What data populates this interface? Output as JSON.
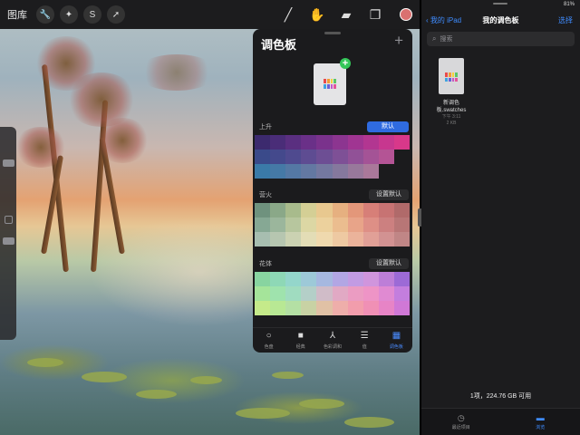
{
  "toolbar": {
    "gallery": "图库",
    "left_icons": [
      "wrench-icon",
      "magic-wand-icon",
      "selection-icon",
      "transform-arrow-icon"
    ],
    "right_tools": [
      "brush-icon",
      "smudge-icon",
      "eraser-icon",
      "layers-icon"
    ],
    "current_color": "#d97070"
  },
  "panel": {
    "title": "调色板",
    "add": "+",
    "palettes": [
      {
        "name": "上升",
        "default_label": "默认",
        "is_default": true,
        "rows": [
          [
            "#3c2a6e",
            "#4a2d78",
            "#5a2f80",
            "#6a3088",
            "#7a328c",
            "#8c3590",
            "#a03592",
            "#b23691",
            "#c7378f",
            "#d8388a"
          ],
          [
            "#3a4a8a",
            "#44498c",
            "#4f4a8f",
            "#5e4c92",
            "#6d4e94",
            "#7e5096",
            "#915197",
            "#a45396",
            "#b45495",
            "#1b1b1d"
          ],
          [
            "#3a7aa8",
            "#4579a6",
            "#5478a4",
            "#6378a2",
            "#7478a0",
            "#85789d",
            "#98789b",
            "#aa789a",
            "#1b1b1d",
            "#1b1b1d"
          ]
        ]
      },
      {
        "name": "营火",
        "default_label": "设置默认",
        "is_default": false,
        "rows": [
          [
            "#6f927e",
            "#8aa888",
            "#a8bb8c",
            "#d4cf95",
            "#e8c88f",
            "#e6b080",
            "#e3977a",
            "#d77f78",
            "#c77373",
            "#b06a6a"
          ],
          [
            "#86a894",
            "#9bb69c",
            "#b7c69e",
            "#dcd7a4",
            "#ecd19d",
            "#ebbd8f",
            "#e8a489",
            "#de8f86",
            "#cc8080",
            "#b87676"
          ],
          [
            "#a7beb0",
            "#b6c6b0",
            "#cbd2b2",
            "#e3ddb6",
            "#efd9ae",
            "#eec9a2",
            "#ebb39b",
            "#e1a097",
            "#d29292",
            "#c08686"
          ]
        ]
      },
      {
        "name": "花体",
        "default_label": "设置默认",
        "is_default": false,
        "rows": [
          [
            "#88d4a0",
            "#8ed8b6",
            "#94d6cb",
            "#9dc9d8",
            "#a6b8e0",
            "#b2a6e4",
            "#c29be3",
            "#d095dd",
            "#bd7ed8",
            "#9c6ad6"
          ],
          [
            "#a5e49a",
            "#9fe3ad",
            "#a0dcc0",
            "#b4cfc8",
            "#d0bcc8",
            "#e1a9c4",
            "#eb9cc2",
            "#ee94c6",
            "#e08ad2",
            "#c37ede"
          ],
          [
            "#c5ea8a",
            "#b8e894",
            "#b4e0a4",
            "#c8d2a4",
            "#e0c1a5",
            "#eeaeaa",
            "#f29dac",
            "#f090b5",
            "#e784c6",
            "#d078d6"
          ]
        ]
      }
    ],
    "tabs": [
      {
        "label": "色盘",
        "icon": "○",
        "name": "disc"
      },
      {
        "label": "经典",
        "icon": "■",
        "name": "classic"
      },
      {
        "label": "色彩调和",
        "icon": "⅄",
        "name": "harmony"
      },
      {
        "label": "值",
        "icon": "☰",
        "name": "value"
      },
      {
        "label": "调色板",
        "icon": "▦",
        "name": "palettes",
        "active": true
      }
    ]
  },
  "files": {
    "status": "81%",
    "back_label": "我的 iPad",
    "title": "我的调色板",
    "select_label": "选择",
    "search_placeholder": "搜索",
    "item": {
      "name_line1": "新调色",
      "name_line2": "板.swatches",
      "date": "下午 3:11",
      "size": "2 KB"
    },
    "storage": "1项，224.76 GB 可用",
    "tabs": [
      {
        "label": "最近项目",
        "icon": "◷"
      },
      {
        "label": "浏览",
        "icon": "▬",
        "active": true
      }
    ]
  },
  "doc_icon_colors": [
    "#e94b4b",
    "#f39c34",
    "#f5d33b",
    "#5cc66a",
    "#3fa3e0",
    "#6a5fd6",
    "#c457c9",
    "#e4559a"
  ]
}
